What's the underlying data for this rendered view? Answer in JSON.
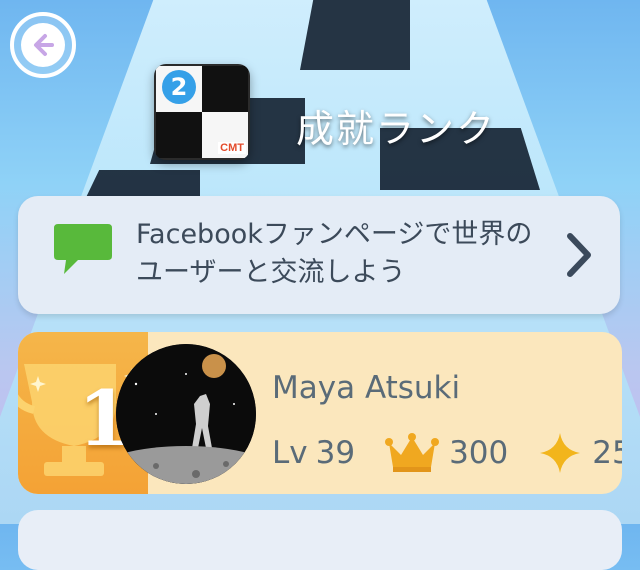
{
  "header": {
    "back_icon": "back-arrow-icon",
    "title": "成就ランク",
    "logo_number": "2",
    "logo_brand": "CMT"
  },
  "facebook_card": {
    "icon": "chat-bubble-icon",
    "text": "Facebookファンページで世界のユーザーと交流しよう",
    "chevron_icon": "chevron-right-icon",
    "accent_color": "#58b93b"
  },
  "leaderboard": [
    {
      "rank": "1",
      "name": "Maya Atsuki",
      "level_label": "Lv",
      "level": "39",
      "crowns": "300",
      "stars": "25",
      "crown_icon": "crown-icon",
      "star_icon": "star-icon",
      "trophy_icon": "gold-trophy-icon"
    }
  ],
  "colors": {
    "card_bg": "#e4ecf6",
    "rank_card_bg": "#fbe7bd",
    "text": "#5a6b78",
    "gold": "#f4a235"
  }
}
